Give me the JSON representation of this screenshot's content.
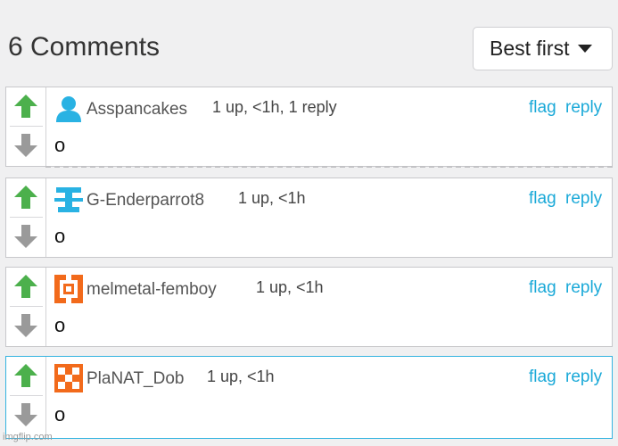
{
  "header": {
    "title": "6 Comments",
    "sort_label": "Best first"
  },
  "comments": [
    {
      "username": "Asspancakes",
      "meta": "1 up, <1h, 1 reply",
      "body": "o",
      "avatar": "person-icon"
    },
    {
      "username": "G-Enderparrot8",
      "meta": "1 up, <1h",
      "body": "o",
      "avatar": "identicon-blue"
    },
    {
      "username": "melmetal-femboy",
      "meta": "1 up, <1h",
      "body": "o",
      "avatar": "identicon-orange"
    },
    {
      "username": "PlaNAT_Dob",
      "meta": "1 up, <1h",
      "body": "o",
      "avatar": "identicon-orange-x"
    }
  ],
  "actions": {
    "flag": "flag",
    "reply": "reply"
  },
  "colors": {
    "upvote": "#4cb04c",
    "downvote": "#9a9a9a",
    "link": "#1aa9d8",
    "avatar_blue": "#29b2e3",
    "avatar_orange": "#f26a1b"
  },
  "watermark": "imgflip.com"
}
